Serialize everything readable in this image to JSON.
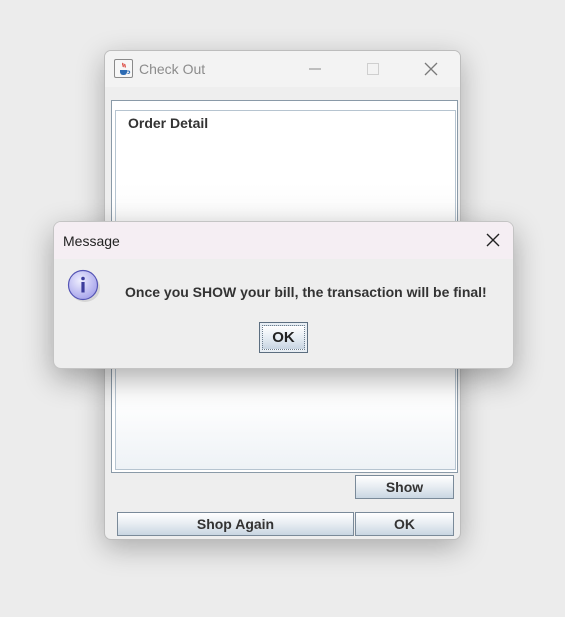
{
  "checkout_window": {
    "title": "Check Out",
    "icon": "java-cup-icon",
    "controls": [
      "minimize-icon",
      "maximize-icon",
      "close-icon"
    ],
    "group_title": "Order Detail",
    "show_button": "Show",
    "shop_again_button": "Shop Again",
    "ok_button": "OK"
  },
  "message_dialog": {
    "title": "Message",
    "icon": "info-icon",
    "message": "Once you SHOW your bill, the transaction will be final!",
    "ok_button": "OK"
  },
  "colors": {
    "desktop_bg": "#ececec",
    "dialog_titlebar_bg": "#f5eef3",
    "info_icon_fill": "#c9c7f5",
    "info_icon_stroke": "#4a4ab0"
  }
}
